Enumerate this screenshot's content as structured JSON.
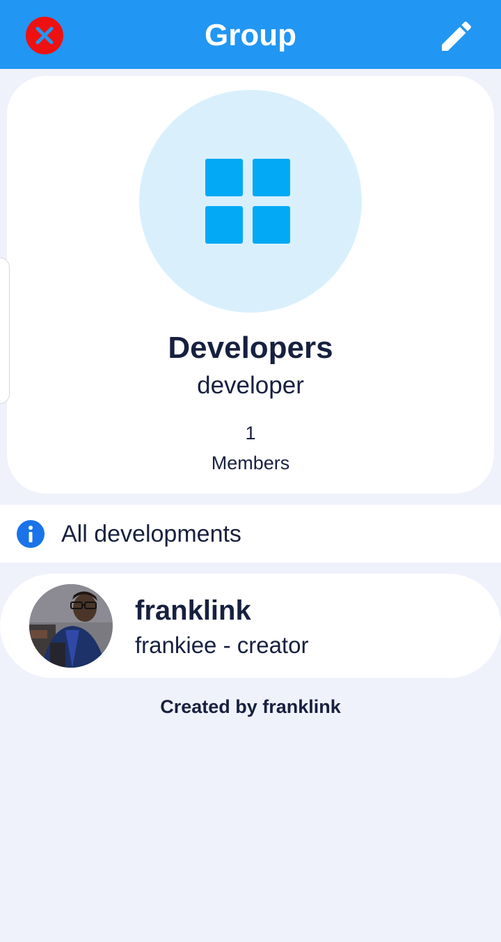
{
  "header": {
    "title": "Group",
    "close_icon": "close-circle-icon",
    "edit_icon": "pencil-icon",
    "background_color": "#2196f3",
    "close_color": "#ee1111"
  },
  "group": {
    "icon": "grid-icon",
    "icon_color": "#03a9f4",
    "avatar_background": "#d9f0fc",
    "name": "Developers",
    "handle": "developer",
    "member_count": "1",
    "member_label": "Members"
  },
  "description": {
    "icon": "info-icon",
    "icon_color": "#1a73e8",
    "text": "All developments"
  },
  "members": [
    {
      "name": "franklink",
      "subtitle": "frankiee - creator",
      "avatar": "user-photo"
    }
  ],
  "footer": {
    "created_by": "Created by franklink"
  }
}
